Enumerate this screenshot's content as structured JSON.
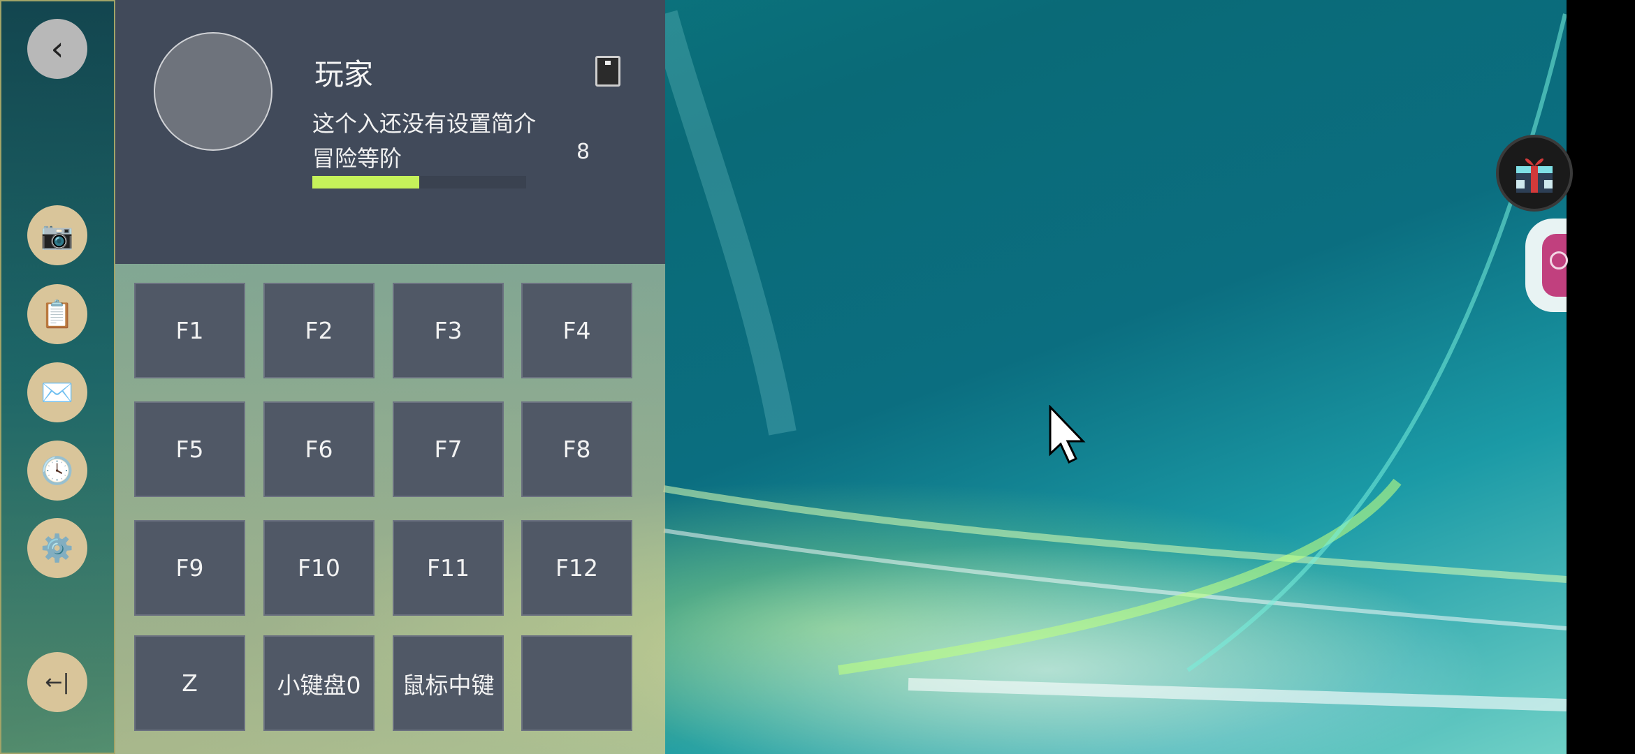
{
  "sidebar": {
    "back_glyph": "‹",
    "items": [
      {
        "icon": "camera-icon",
        "glyph": "📷"
      },
      {
        "icon": "clipboard-icon",
        "glyph": "📋"
      },
      {
        "icon": "mail-icon",
        "glyph": "✉️"
      },
      {
        "icon": "clock-icon",
        "glyph": "🕓"
      },
      {
        "icon": "gear-icon",
        "glyph": "⚙️"
      }
    ],
    "exit_glyph": "←|"
  },
  "profile": {
    "name": "玩家",
    "bio": "这个入还没有设置简介",
    "level_label": "冒险等阶",
    "level_value": "8",
    "level_progress_fraction": 0.5
  },
  "keys": [
    "F1",
    "F2",
    "F3",
    "F4",
    "F5",
    "F6",
    "F7",
    "F8",
    "F9",
    "F10",
    "F11",
    "F12",
    "Z",
    "小键盘0",
    "鼠标中键",
    ""
  ],
  "colors": {
    "panel_header": "#414a5a",
    "key_bg": "#505866",
    "accent_bar": "#c5f25a",
    "sidebar_button": "#d9c59a"
  }
}
